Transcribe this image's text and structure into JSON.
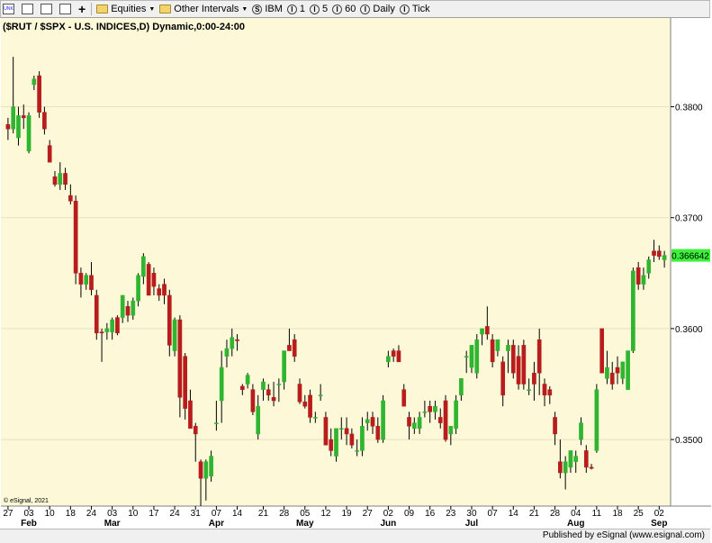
{
  "toolbar": {
    "unk_label": "UNK",
    "equities_label": "Equities",
    "other_intervals_label": "Other Intervals",
    "ibm_label": "IBM",
    "i1_label": "1",
    "i5_label": "5",
    "i60_label": "60",
    "daily_label": "Daily",
    "tick_label": "Tick"
  },
  "footer": {
    "published_by": "Published by eSignal (www.esignal.com)"
  },
  "colors": {
    "bg": "#fcf8d8",
    "up": "#2fb52f",
    "down": "#b81c1c",
    "last": "#3cf03c",
    "grid": "#e9e3bd"
  },
  "chart_data": {
    "type": "candlestick",
    "title": "($RUT / $SPX - U.S. INDICES,D) Dynamic,0:00-24:00",
    "copyright": "© eSignal, 2021",
    "last_value_label": "0.366642",
    "ylim": [
      0.344,
      0.388
    ],
    "yticks": [
      0.35,
      0.36,
      0.37,
      0.38
    ],
    "ytick_labels": [
      "0.3500",
      "0.3600",
      "0.3700",
      "0.3800"
    ],
    "xtick_labels": [
      "27",
      "03",
      "10",
      "18",
      "24",
      "03",
      "10",
      "17",
      "24",
      "31",
      "07",
      "14",
      "21",
      "28",
      "05",
      "12",
      "19",
      "27",
      "02",
      "09",
      "16",
      "23",
      "30",
      "07",
      "14",
      "21",
      "28",
      "04",
      "11",
      "18",
      "25",
      "02"
    ],
    "month_labels": [
      {
        "label": "Feb",
        "at": 1
      },
      {
        "label": "Mar",
        "at": 5
      },
      {
        "label": "Apr",
        "at": 10
      },
      {
        "label": "May",
        "at": 14
      },
      {
        "label": "Jun",
        "at": 18
      },
      {
        "label": "Jul",
        "at": 22
      },
      {
        "label": "Aug",
        "at": 27
      },
      {
        "label": "Sep",
        "at": 31
      }
    ],
    "ohlc": [
      [
        0.3784,
        0.379,
        0.377,
        0.378
      ],
      [
        0.378,
        0.3845,
        0.3776,
        0.38
      ],
      [
        0.3772,
        0.38,
        0.3765,
        0.3792
      ],
      [
        0.3792,
        0.3802,
        0.378,
        0.379
      ],
      [
        0.376,
        0.3795,
        0.3758,
        0.3792
      ],
      [
        0.382,
        0.3828,
        0.3815,
        0.3825
      ],
      [
        0.3828,
        0.3832,
        0.379,
        0.3795
      ],
      [
        0.3795,
        0.38,
        0.3775,
        0.378
      ],
      [
        0.3765,
        0.377,
        0.375,
        0.375
      ],
      [
        0.3737,
        0.3742,
        0.3728,
        0.373
      ],
      [
        0.373,
        0.375,
        0.3725,
        0.374
      ],
      [
        0.374,
        0.3745,
        0.3725,
        0.373
      ],
      [
        0.372,
        0.373,
        0.3712,
        0.3715
      ],
      [
        0.3715,
        0.372,
        0.364,
        0.365
      ],
      [
        0.365,
        0.3655,
        0.3628,
        0.364
      ],
      [
        0.364,
        0.365,
        0.3635,
        0.3648
      ],
      [
        0.3648,
        0.366,
        0.363,
        0.3635
      ],
      [
        0.363,
        0.3635,
        0.359,
        0.3596
      ],
      [
        0.3597,
        0.36,
        0.357,
        0.3596
      ],
      [
        0.3597,
        0.3605,
        0.359,
        0.36
      ],
      [
        0.3597,
        0.361,
        0.359,
        0.3608
      ],
      [
        0.361,
        0.3612,
        0.3594,
        0.3596
      ],
      [
        0.361,
        0.363,
        0.3605,
        0.363
      ],
      [
        0.362,
        0.3625,
        0.3606,
        0.3612
      ],
      [
        0.3612,
        0.3628,
        0.3608,
        0.3625
      ],
      [
        0.3625,
        0.365,
        0.362,
        0.3648
      ],
      [
        0.3647,
        0.3668,
        0.364,
        0.3665
      ],
      [
        0.3658,
        0.366,
        0.363,
        0.363
      ],
      [
        0.365,
        0.3655,
        0.363,
        0.3638
      ],
      [
        0.3636,
        0.364,
        0.3625,
        0.363
      ],
      [
        0.364,
        0.3645,
        0.3622,
        0.363
      ],
      [
        0.363,
        0.3635,
        0.3575,
        0.3585
      ],
      [
        0.358,
        0.361,
        0.3575,
        0.3608
      ],
      [
        0.3608,
        0.3612,
        0.352,
        0.3538
      ],
      [
        0.3575,
        0.3578,
        0.3518,
        0.3528
      ],
      [
        0.3535,
        0.3545,
        0.351,
        0.351
      ],
      [
        0.3512,
        0.3515,
        0.348,
        0.3505
      ],
      [
        0.348,
        0.3482,
        0.344,
        0.3465
      ],
      [
        0.3465,
        0.3482,
        0.3445,
        0.348
      ],
      [
        0.3467,
        0.349,
        0.3462,
        0.3485
      ],
      [
        0.3515,
        0.3535,
        0.3508,
        0.3515
      ],
      [
        0.3535,
        0.358,
        0.3515,
        0.3565
      ],
      [
        0.3575,
        0.359,
        0.3565,
        0.3582
      ],
      [
        0.3582,
        0.36,
        0.3575,
        0.3592
      ],
      [
        0.359,
        0.3595,
        0.358,
        0.3589
      ],
      [
        0.3548,
        0.355,
        0.354,
        0.3545
      ],
      [
        0.355,
        0.356,
        0.3546,
        0.3558
      ],
      [
        0.3545,
        0.355,
        0.3522,
        0.3525
      ],
      [
        0.3505,
        0.354,
        0.35,
        0.353
      ],
      [
        0.3545,
        0.3555,
        0.3535,
        0.3552
      ],
      [
        0.3545,
        0.355,
        0.3535,
        0.354
      ],
      [
        0.3538,
        0.3552,
        0.353,
        0.3535
      ],
      [
        0.355,
        0.3555,
        0.3534,
        0.355
      ],
      [
        0.3552,
        0.358,
        0.3545,
        0.358
      ],
      [
        0.3585,
        0.36,
        0.358,
        0.358
      ],
      [
        0.359,
        0.3595,
        0.357,
        0.3575
      ],
      [
        0.355,
        0.3555,
        0.3532,
        0.3534
      ],
      [
        0.3534,
        0.354,
        0.3528,
        0.353
      ],
      [
        0.354,
        0.3545,
        0.3515,
        0.352
      ],
      [
        0.352,
        0.3525,
        0.3515,
        0.352
      ],
      [
        0.354,
        0.355,
        0.3535,
        0.354
      ],
      [
        0.352,
        0.3525,
        0.3495,
        0.3495
      ],
      [
        0.35,
        0.351,
        0.3485,
        0.349
      ],
      [
        0.3485,
        0.351,
        0.348,
        0.351
      ],
      [
        0.351,
        0.352,
        0.35,
        0.351
      ],
      [
        0.351,
        0.352,
        0.3495,
        0.3505
      ],
      [
        0.3505,
        0.351,
        0.3492,
        0.3495
      ],
      [
        0.349,
        0.35,
        0.3485,
        0.349
      ],
      [
        0.349,
        0.352,
        0.3485,
        0.3512
      ],
      [
        0.3515,
        0.3525,
        0.3508,
        0.3518
      ],
      [
        0.352,
        0.3525,
        0.3505,
        0.3512
      ],
      [
        0.3512,
        0.352,
        0.3497,
        0.35
      ],
      [
        0.35,
        0.354,
        0.3497,
        0.3535
      ],
      [
        0.357,
        0.358,
        0.3565,
        0.3575
      ],
      [
        0.358,
        0.3582,
        0.357,
        0.3575
      ],
      [
        0.358,
        0.3585,
        0.357,
        0.357
      ],
      [
        0.3545,
        0.355,
        0.353,
        0.353
      ],
      [
        0.352,
        0.3525,
        0.35,
        0.3512
      ],
      [
        0.351,
        0.352,
        0.3505,
        0.3515
      ],
      [
        0.351,
        0.3525,
        0.3505,
        0.352
      ],
      [
        0.3525,
        0.3535,
        0.352,
        0.3525
      ],
      [
        0.353,
        0.3535,
        0.3515,
        0.3525
      ],
      [
        0.3525,
        0.3535,
        0.3518,
        0.353
      ],
      [
        0.352,
        0.3528,
        0.351,
        0.3515
      ],
      [
        0.3535,
        0.354,
        0.3498,
        0.35
      ],
      [
        0.3505,
        0.3512,
        0.3495,
        0.3512
      ],
      [
        0.351,
        0.354,
        0.3505,
        0.3535
      ],
      [
        0.354,
        0.3555,
        0.3535,
        0.3555
      ],
      [
        0.3575,
        0.358,
        0.356,
        0.3575
      ],
      [
        0.3565,
        0.3585,
        0.356,
        0.3585
      ],
      [
        0.356,
        0.3595,
        0.3555,
        0.359
      ],
      [
        0.3595,
        0.36,
        0.3585,
        0.36
      ],
      [
        0.3602,
        0.362,
        0.359,
        0.3595
      ],
      [
        0.359,
        0.3595,
        0.3565,
        0.357
      ],
      [
        0.358,
        0.359,
        0.3575,
        0.359
      ],
      [
        0.357,
        0.3575,
        0.353,
        0.354
      ],
      [
        0.358,
        0.359,
        0.356,
        0.3585
      ],
      [
        0.3585,
        0.359,
        0.3555,
        0.356
      ],
      [
        0.3575,
        0.3585,
        0.3545,
        0.355
      ],
      [
        0.3585,
        0.359,
        0.3545,
        0.355
      ],
      [
        0.3545,
        0.3555,
        0.354,
        0.3545
      ],
      [
        0.356,
        0.357,
        0.3535,
        0.355
      ],
      [
        0.359,
        0.36,
        0.354,
        0.356
      ],
      [
        0.355,
        0.3555,
        0.353,
        0.354
      ],
      [
        0.3545,
        0.3548,
        0.3532,
        0.354
      ],
      [
        0.352,
        0.3525,
        0.3495,
        0.3505
      ],
      [
        0.348,
        0.35,
        0.3465,
        0.347
      ],
      [
        0.347,
        0.3485,
        0.3455,
        0.348
      ],
      [
        0.3475,
        0.349,
        0.347,
        0.349
      ],
      [
        0.348,
        0.349,
        0.347,
        0.3485
      ],
      [
        0.35,
        0.352,
        0.3495,
        0.3515
      ],
      [
        0.349,
        0.3495,
        0.347,
        0.3475
      ],
      [
        0.3475,
        0.3478,
        0.3473,
        0.3474
      ],
      [
        0.349,
        0.355,
        0.3488,
        0.3545
      ],
      [
        0.36,
        0.36,
        0.356,
        0.356
      ],
      [
        0.3555,
        0.358,
        0.355,
        0.3565
      ],
      [
        0.356,
        0.357,
        0.3545,
        0.355
      ],
      [
        0.3565,
        0.3575,
        0.355,
        0.356
      ],
      [
        0.3555,
        0.357,
        0.355,
        0.357
      ],
      [
        0.3545,
        0.358,
        0.3545,
        0.358
      ],
      [
        0.358,
        0.3655,
        0.3578,
        0.3652
      ],
      [
        0.3655,
        0.366,
        0.3635,
        0.364
      ],
      [
        0.364,
        0.3655,
        0.3635,
        0.3648
      ],
      [
        0.365,
        0.3665,
        0.3645,
        0.3662
      ],
      [
        0.367,
        0.368,
        0.366,
        0.3666
      ],
      [
        0.367,
        0.3675,
        0.3662,
        0.3665
      ],
      [
        0.3662,
        0.367,
        0.3655,
        0.3666
      ]
    ]
  }
}
